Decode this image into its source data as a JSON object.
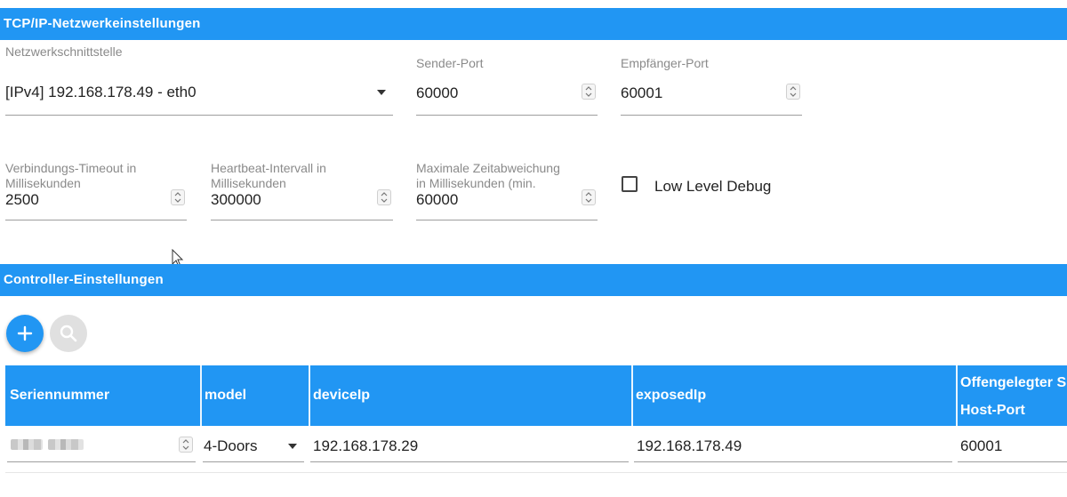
{
  "tcp_section": {
    "title": "TCP/IP-Netzwerkeinstellungen"
  },
  "network_interface": {
    "label": "Netzwerkschnittstelle",
    "value": "[IPv4] 192.168.178.49 - eth0"
  },
  "sender_port": {
    "label": "Sender-Port",
    "value": "60000"
  },
  "receiver_port": {
    "label": "Empfänger-Port",
    "value": "60001"
  },
  "connection_timeout": {
    "label_line1": "Verbindungs-Timeout in",
    "label_line2": "Millisekunden",
    "value": "2500"
  },
  "heartbeat_interval": {
    "label_line1": "Heartbeat-Intervall in",
    "label_line2": "Millisekunden",
    "value": "300000"
  },
  "max_time_deviation": {
    "label_line1": "Maximale Zeitabweichung",
    "label_line2": "in Millisekunden (min.",
    "value": "60000"
  },
  "low_level_debug": {
    "label": "Low Level Debug",
    "checked": false
  },
  "controller_section": {
    "title": "Controller-Einstellungen"
  },
  "table": {
    "headers": {
      "serial": "Seriennummer",
      "model": "model",
      "device_ip": "deviceIp",
      "exposed_ip": "exposedIp",
      "exposed_line1": "Offengelegter S",
      "exposed_line2": "Host-Port"
    },
    "rows": [
      {
        "serial": "",
        "model": "4-Doors",
        "device_ip": "192.168.178.29",
        "exposed_ip": "192.168.178.49",
        "host_port": "60001"
      }
    ]
  },
  "colors": {
    "accent": "#2196f3",
    "fab_disabled": "#e0e0e0"
  },
  "icons": {
    "add": "plus-icon",
    "search": "search-icon"
  }
}
